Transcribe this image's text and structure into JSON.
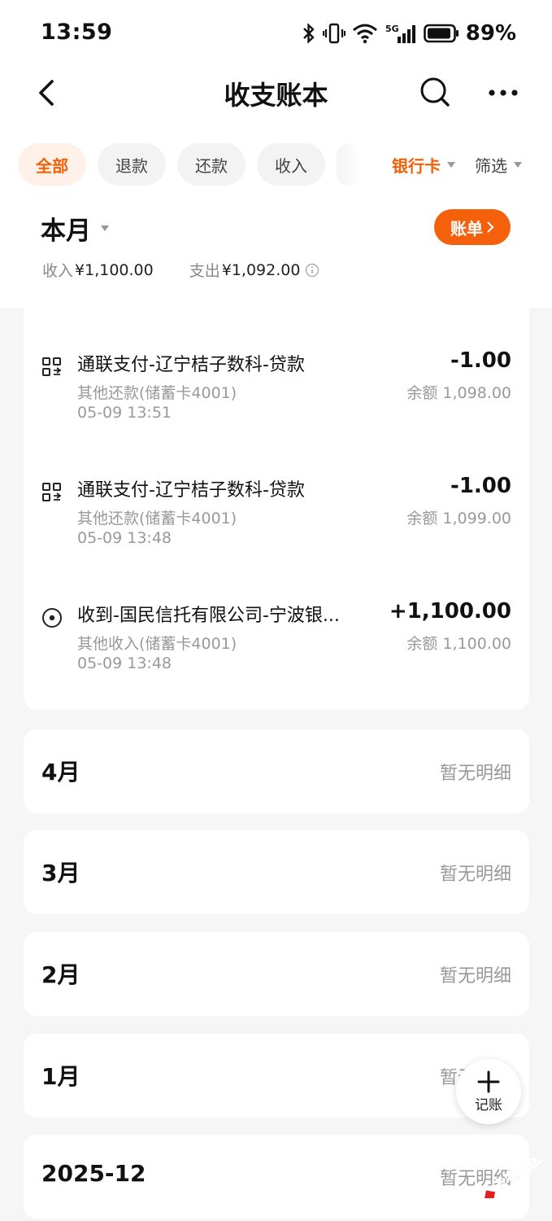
{
  "status_bar": {
    "time": "13:59",
    "battery": "89%"
  },
  "header": {
    "title": "收支账本"
  },
  "filters": {
    "chips": [
      "全部",
      "退款",
      "还款",
      "收入"
    ],
    "bank_card": "银行卡",
    "filter": "筛选"
  },
  "summary": {
    "period": "本月",
    "bill_button": "账单",
    "income_label": "收入",
    "income_value": "¥1,100.00",
    "expense_label": "支出",
    "expense_value": "¥1,092.00"
  },
  "transactions": [
    {
      "icon": "scan-pay-icon",
      "title": "通联支付-辽宁桔子数科-贷款",
      "category": "其他还款(储蓄卡4001)",
      "time": "05-09 13:51",
      "amount": "-1.00",
      "balance": "余额 1,098.00"
    },
    {
      "icon": "scan-pay-icon",
      "title": "通联支付-辽宁桔子数科-贷款",
      "category": "其他还款(储蓄卡4001)",
      "time": "05-09 13:48",
      "amount": "-1.00",
      "balance": "余额 1,099.00"
    },
    {
      "icon": "income-icon",
      "title": "收到-国民信托有限公司-宁波银...",
      "category": "其他收入(储蓄卡4001)",
      "time": "05-09 13:48",
      "amount": "+1,100.00",
      "balance": "余额 1,100.00"
    }
  ],
  "months": [
    {
      "label": "4月",
      "status": "暂无明细"
    },
    {
      "label": "3月",
      "status": "暂无明细"
    },
    {
      "label": "2月",
      "status": "暂无明细"
    },
    {
      "label": "1月",
      "status": "暂无明细"
    },
    {
      "label": "2025-12",
      "status": "暂无明细"
    }
  ],
  "fab": {
    "label": "记账"
  },
  "watermark": "卡农社区",
  "colors": {
    "accent": "#f4600c",
    "chip_active_bg": "#fff1e8",
    "background": "#f6f6f6"
  }
}
